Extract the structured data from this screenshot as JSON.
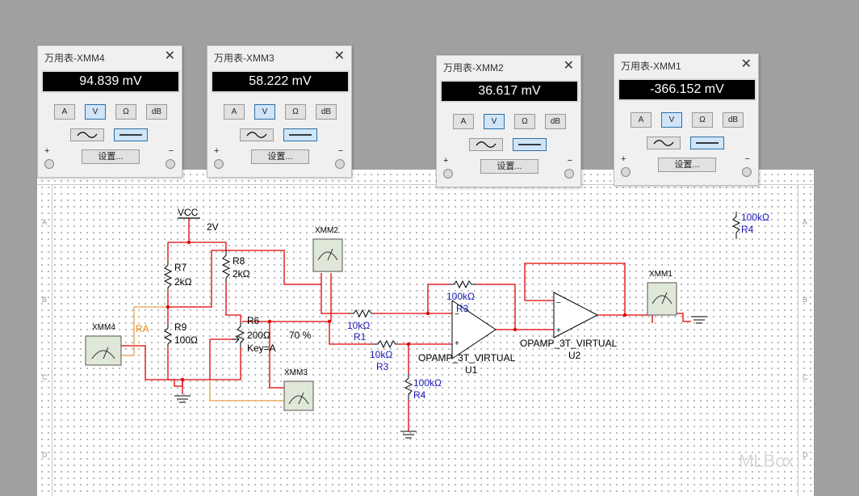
{
  "multimeters": [
    {
      "id": "xmm4",
      "title": "万用表-XMM4",
      "reading": "94.839 mV"
    },
    {
      "id": "xmm3",
      "title": "万用表-XMM3",
      "reading": "58.222 mV"
    },
    {
      "id": "xmm2",
      "title": "万用表-XMM2",
      "reading": "36.617 mV"
    },
    {
      "id": "xmm1",
      "title": "万用表-XMM1",
      "reading": "-366.152 mV"
    }
  ],
  "meter_buttons": {
    "a": "A",
    "v": "V",
    "ohm": "Ω",
    "db": "dB",
    "settings": "设置...",
    "plus": "+",
    "minus": "−",
    "active_mode": "V",
    "active_wave": "DC"
  },
  "schematic": {
    "vcc": "VCC",
    "vcc_value": "2V",
    "r7": "R7",
    "r7_value": "2kΩ",
    "r8": "R8",
    "r8_value": "2kΩ",
    "r9": "R9",
    "r9_value": "100Ω",
    "r6": "R6",
    "r6_value": "200Ω",
    "r6_key": "Key=A",
    "r6_pct": "70 %",
    "ra": "RA",
    "r1": "R1",
    "r1_value": "10kΩ",
    "r3a": "R3",
    "r3a_value": "10kΩ",
    "r3b": "R3",
    "r3b_value": "100kΩ",
    "r4a": "R4",
    "r4a_value": "100kΩ",
    "r4b": "R4",
    "r4b_value": "100kΩ",
    "u1": "U1",
    "u1_type": "OPAMP_3T_VIRTUAL",
    "u2": "U2",
    "u2_type": "OPAMP_3T_VIRTUAL",
    "xmm1": "XMM1",
    "xmm2": "XMM2",
    "xmm3": "XMM3",
    "xmm4": "XMM4",
    "row_letters": [
      "A",
      "B",
      "C",
      "D"
    ]
  },
  "watermark": "MLBox",
  "colors": {
    "wire": "#e00000",
    "wire_orange": "#e8a050",
    "window_bg": "#f0f0f0",
    "display_bg": "#000000"
  }
}
